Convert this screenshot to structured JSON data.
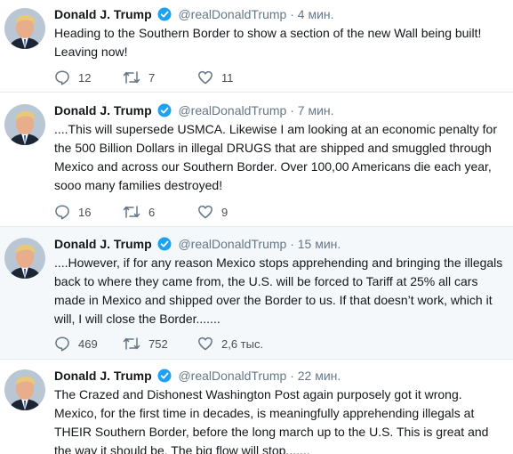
{
  "tweets": [
    {
      "name": "Donald J. Trump",
      "handle": "@realDonaldTrump",
      "time": "· 4 мин.",
      "text": "Heading to the Southern Border to show a section of the new Wall being built! Leaving now!",
      "replies": "12",
      "retweets": "7",
      "likes": "11"
    },
    {
      "name": "Donald J. Trump",
      "handle": "@realDonaldTrump",
      "time": "· 7 мин.",
      "text": "....This will supersede USMCA. Likewise I am looking at an economic penalty for the 500 Billion Dollars in illegal DRUGS that are shipped and smuggled through Mexico and across our Southern Border. Over 100,00 Americans die each year, sooo many families destroyed!",
      "replies": "16",
      "retweets": "6",
      "likes": "9"
    },
    {
      "name": "Donald J. Trump",
      "handle": "@realDonaldTrump",
      "time": "· 15 мин.",
      "text": "....However, if for any reason Mexico stops apprehending and bringing the illegals back to where they came from, the U.S. will be forced to Tariff at 25% all cars made in Mexico and shipped over the Border to us. If that doesn’t work, which it will, I will close the Border.......",
      "replies": "469",
      "retweets": "752",
      "likes": "2,6 тыс."
    },
    {
      "name": "Donald J. Trump",
      "handle": "@realDonaldTrump",
      "time": "· 22 мин.",
      "text": "The Crazed and Dishonest Washington Post again purposely got it wrong. Mexico, for the first time in decades, is meaningfully apprehending illegals at THEIR Southern Border, before the long march up to the U.S. This is great and the way it should be. The big flow will stop.......",
      "replies": "",
      "retweets": "",
      "likes": ""
    }
  ],
  "colors": {
    "text": "#14171a",
    "secondary": "#657786",
    "verified": "#1da1f2",
    "divider": "#e6ecf0",
    "highlight_bg": "#f5f8fa"
  },
  "icons": [
    "avatar",
    "verified-badge-icon",
    "reply-icon",
    "retweet-icon",
    "like-icon"
  ]
}
